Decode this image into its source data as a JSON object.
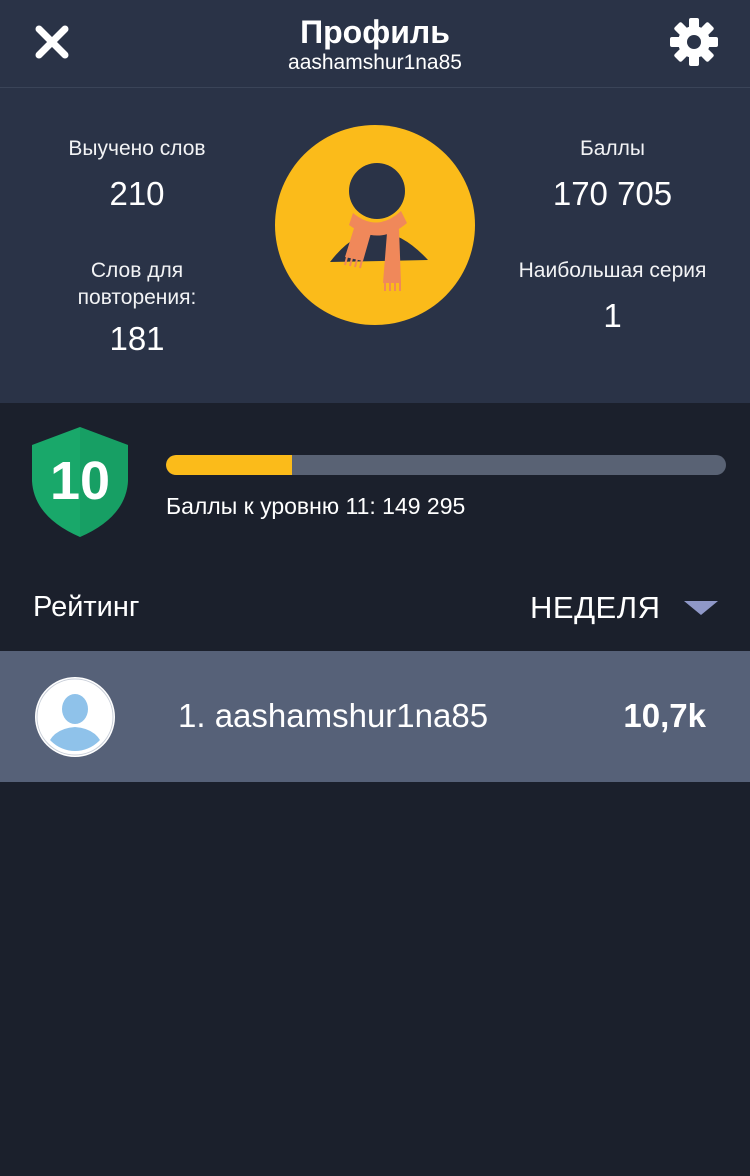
{
  "header": {
    "title": "Профиль",
    "username": "aashamshur1na85",
    "close_icon": "close-icon",
    "settings_icon": "gear-icon"
  },
  "stats": {
    "learned_label": "Выучено слов",
    "learned_value": "210",
    "repeat_label": "Слов для повторения:",
    "repeat_value": "181",
    "points_label": "Баллы",
    "points_value": "170 705",
    "streak_label": "Наибольшая серия",
    "streak_value": "1",
    "avatar_icon": "user-with-scarf-icon"
  },
  "level": {
    "number": "10",
    "progress": 0.225,
    "next_text": "Баллы к уровню 11: 149 295"
  },
  "rating": {
    "title": "Рейтинг",
    "period": "НЕДЕЛЯ",
    "rows": [
      {
        "position_name": "1. aashamshur1na85",
        "score": "10,7k"
      }
    ]
  },
  "colors": {
    "accent_yellow": "#fbbb1a",
    "shield_green": "#19a86a",
    "header_bg": "#2a3347",
    "page_bg": "#1b202c",
    "row_bg": "#566178"
  }
}
